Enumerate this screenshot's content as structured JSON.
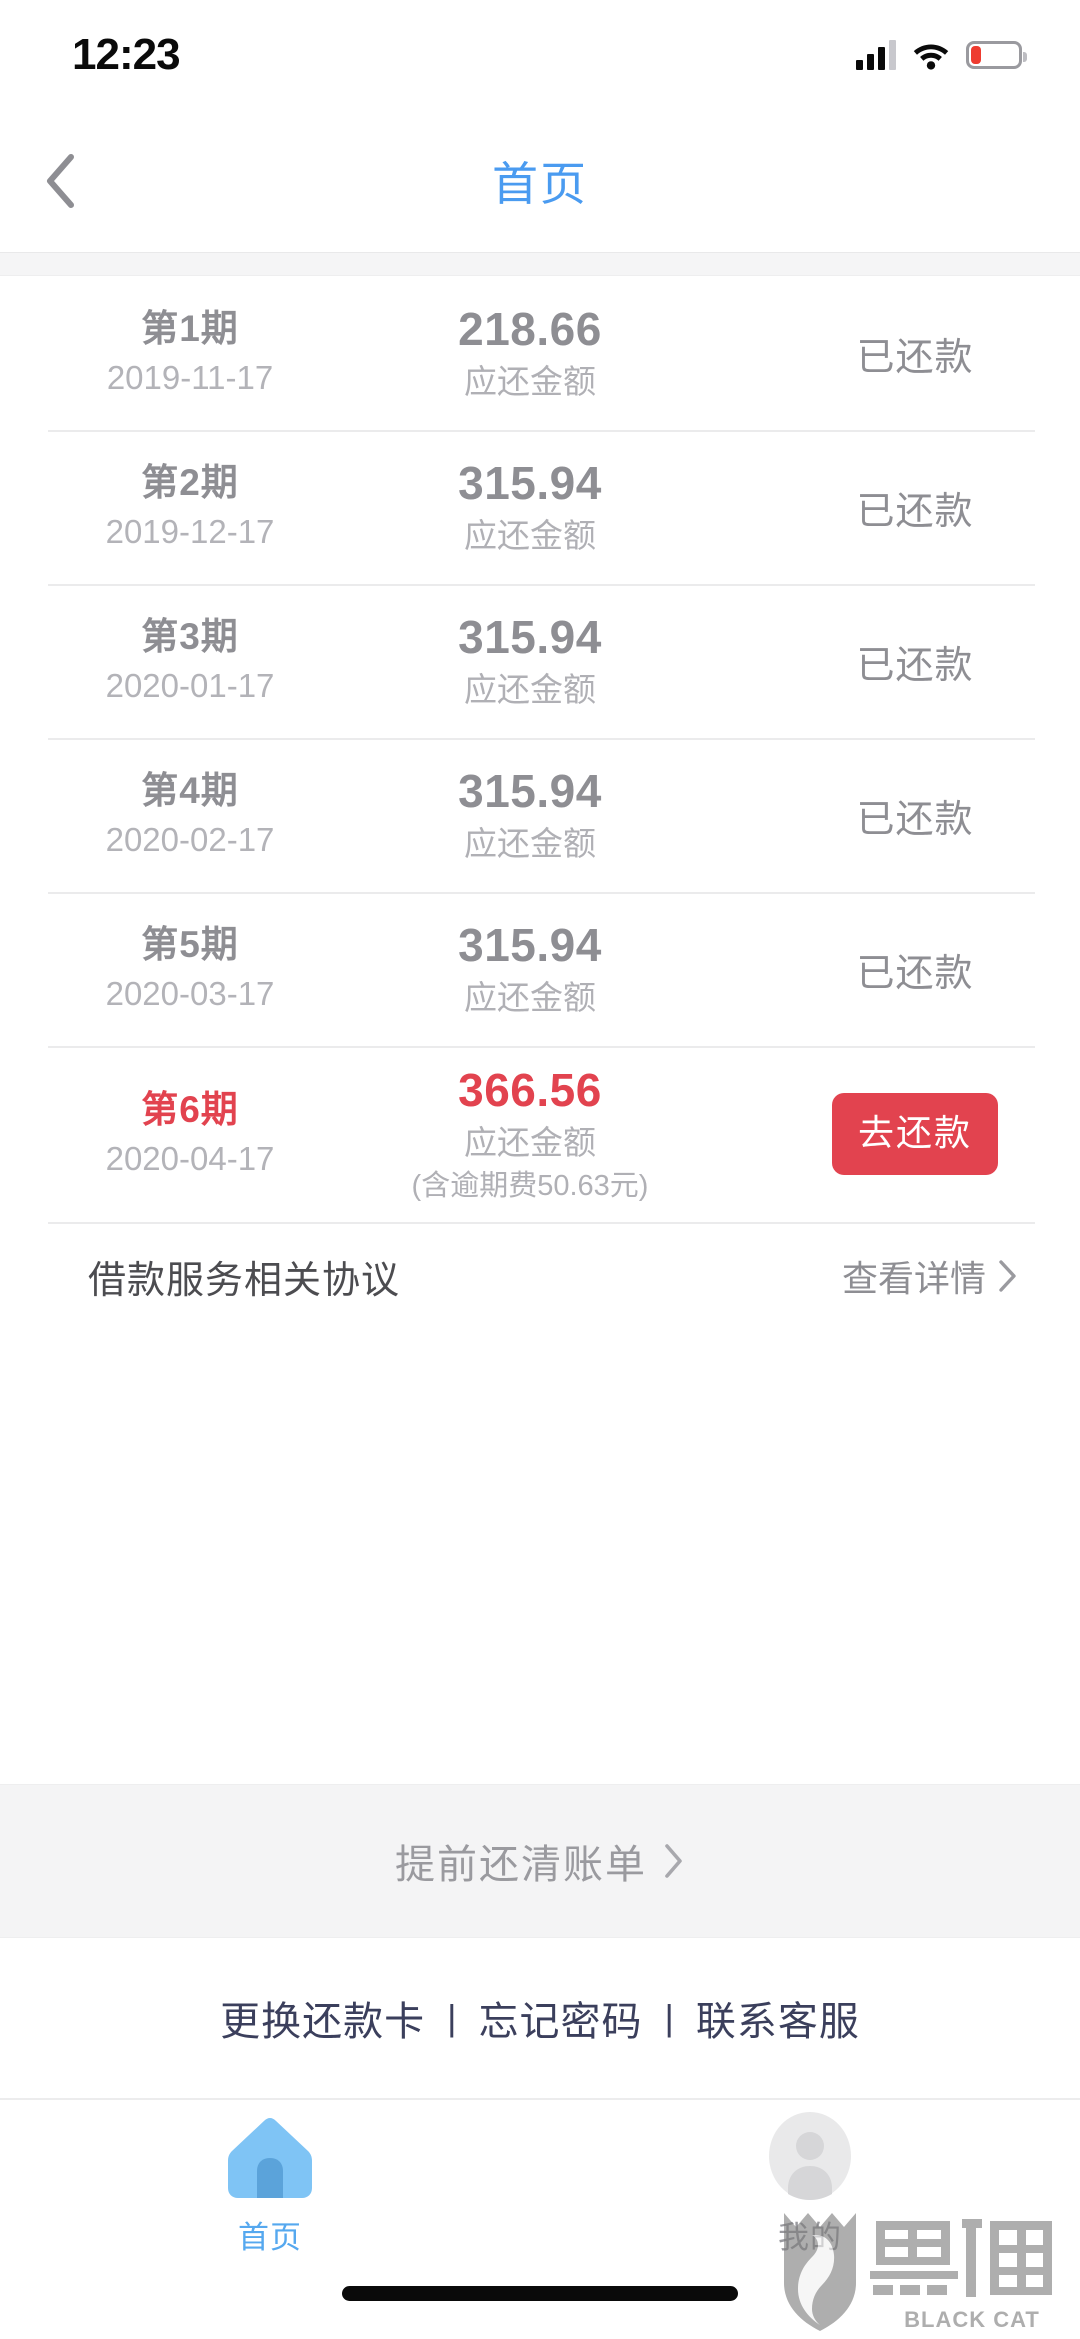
{
  "status_bar": {
    "time": "12:23",
    "signal_icon": "cellular-signal-icon",
    "wifi_icon": "wifi-icon",
    "battery_icon": "battery-low-icon",
    "battery_level_percent": 20,
    "battery_color": "#ee3b30"
  },
  "header": {
    "back_icon": "back-chevron-icon",
    "title": "首页",
    "title_color": "#4a9bf0"
  },
  "bills": {
    "amount_caption": "应还金额",
    "rows": [
      {
        "period": "第1期",
        "date": "2019-11-17",
        "amount": "218.66",
        "caption": "应还金额",
        "status": "已还款",
        "overdue": false
      },
      {
        "period": "第2期",
        "date": "2019-12-17",
        "amount": "315.94",
        "caption": "应还金额",
        "status": "已还款",
        "overdue": false
      },
      {
        "period": "第3期",
        "date": "2020-01-17",
        "amount": "315.94",
        "caption": "应还金额",
        "status": "已还款",
        "overdue": false
      },
      {
        "period": "第4期",
        "date": "2020-02-17",
        "amount": "315.94",
        "caption": "应还金额",
        "status": "已还款",
        "overdue": false
      },
      {
        "period": "第5期",
        "date": "2020-03-17",
        "amount": "315.94",
        "caption": "应还金额",
        "status": "已还款",
        "overdue": false
      },
      {
        "period": "第6期",
        "date": "2020-04-17",
        "amount": "366.56",
        "caption": "应还金额",
        "note": "(含逾期费50.63元)",
        "button_label": "去还款",
        "overdue": true
      }
    ],
    "overdue_color": "#e2434f"
  },
  "agreement": {
    "label": "借款服务相关协议",
    "action_label": "查看详情",
    "chevron_icon": "chevron-right-icon"
  },
  "payoff": {
    "label": "提前还清账单",
    "chevron_icon": "chevron-right-icon"
  },
  "footer_links": {
    "items": [
      {
        "label": "更换还款卡"
      },
      {
        "label": "忘记密码"
      },
      {
        "label": "联系客服"
      }
    ],
    "separator": "|",
    "color": "#3b3f5c"
  },
  "tab_bar": {
    "items": [
      {
        "label": "首页",
        "icon": "home-icon",
        "active": true
      },
      {
        "label": "我的",
        "icon": "user-avatar-icon",
        "active": false
      }
    ],
    "active_color": "#55a8ef",
    "inactive_color": "#9a9a9f"
  },
  "watermark": {
    "name_cn": "黑猫",
    "name_en": "BLACK CAT",
    "icon": "black-cat-shield-logo"
  }
}
